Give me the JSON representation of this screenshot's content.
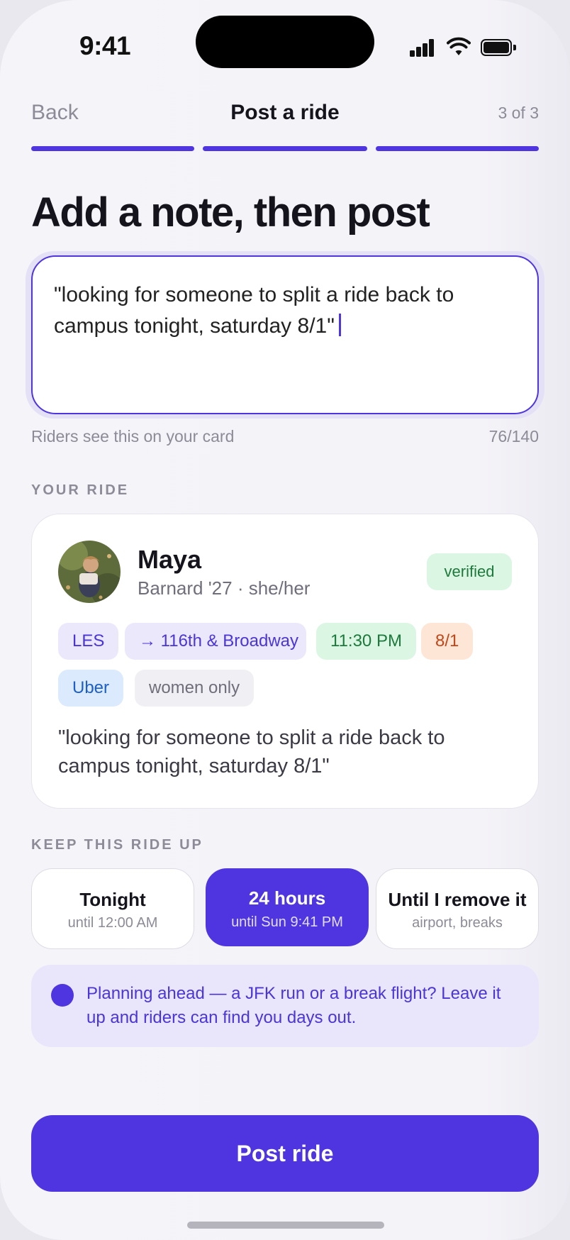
{
  "status_bar": {
    "time": "9:41"
  },
  "header": {
    "back_label": "Back",
    "title": "Post a ride",
    "step": "3 of 3",
    "progress_segments_complete": 3,
    "progress_segments_total": 3
  },
  "headline": "Add a note, then post",
  "note_input": {
    "value": "\"looking for someone to split a ride back to campus tonight, saturday 8/1\"",
    "hint": "Riders see this on your card",
    "counter": "76/140"
  },
  "your_ride": {
    "section_label": "YOUR RIDE",
    "name": "Maya",
    "meta": "Barnard '27 · she/her",
    "badge": "verified",
    "tags": {
      "from": "LES",
      "to": "→ 116th & Broadway",
      "time": "11:30 PM",
      "date": "8/1",
      "service": "Uber",
      "preference": "women only"
    },
    "note": "\"looking for someone to split a ride back to campus tonight, saturday 8/1\""
  },
  "duration": {
    "section_label": "KEEP THIS RIDE UP",
    "options": [
      {
        "title": "Tonight",
        "subtitle": "until 12:00 AM",
        "selected": false
      },
      {
        "title": "24 hours",
        "subtitle": "until Sun 9:41 PM",
        "selected": true
      },
      {
        "title": "Until I remove it",
        "subtitle": "airport, breaks",
        "selected": false
      }
    ]
  },
  "tip": {
    "text": "Planning ahead — a JFK run or a break flight? Leave it up and riders can find you days out."
  },
  "post_button": {
    "label": "Post ride"
  },
  "colors": {
    "accent": "#4f35e0",
    "verified_bg": "#dbf6e3",
    "verified_text": "#1d7a3c"
  }
}
